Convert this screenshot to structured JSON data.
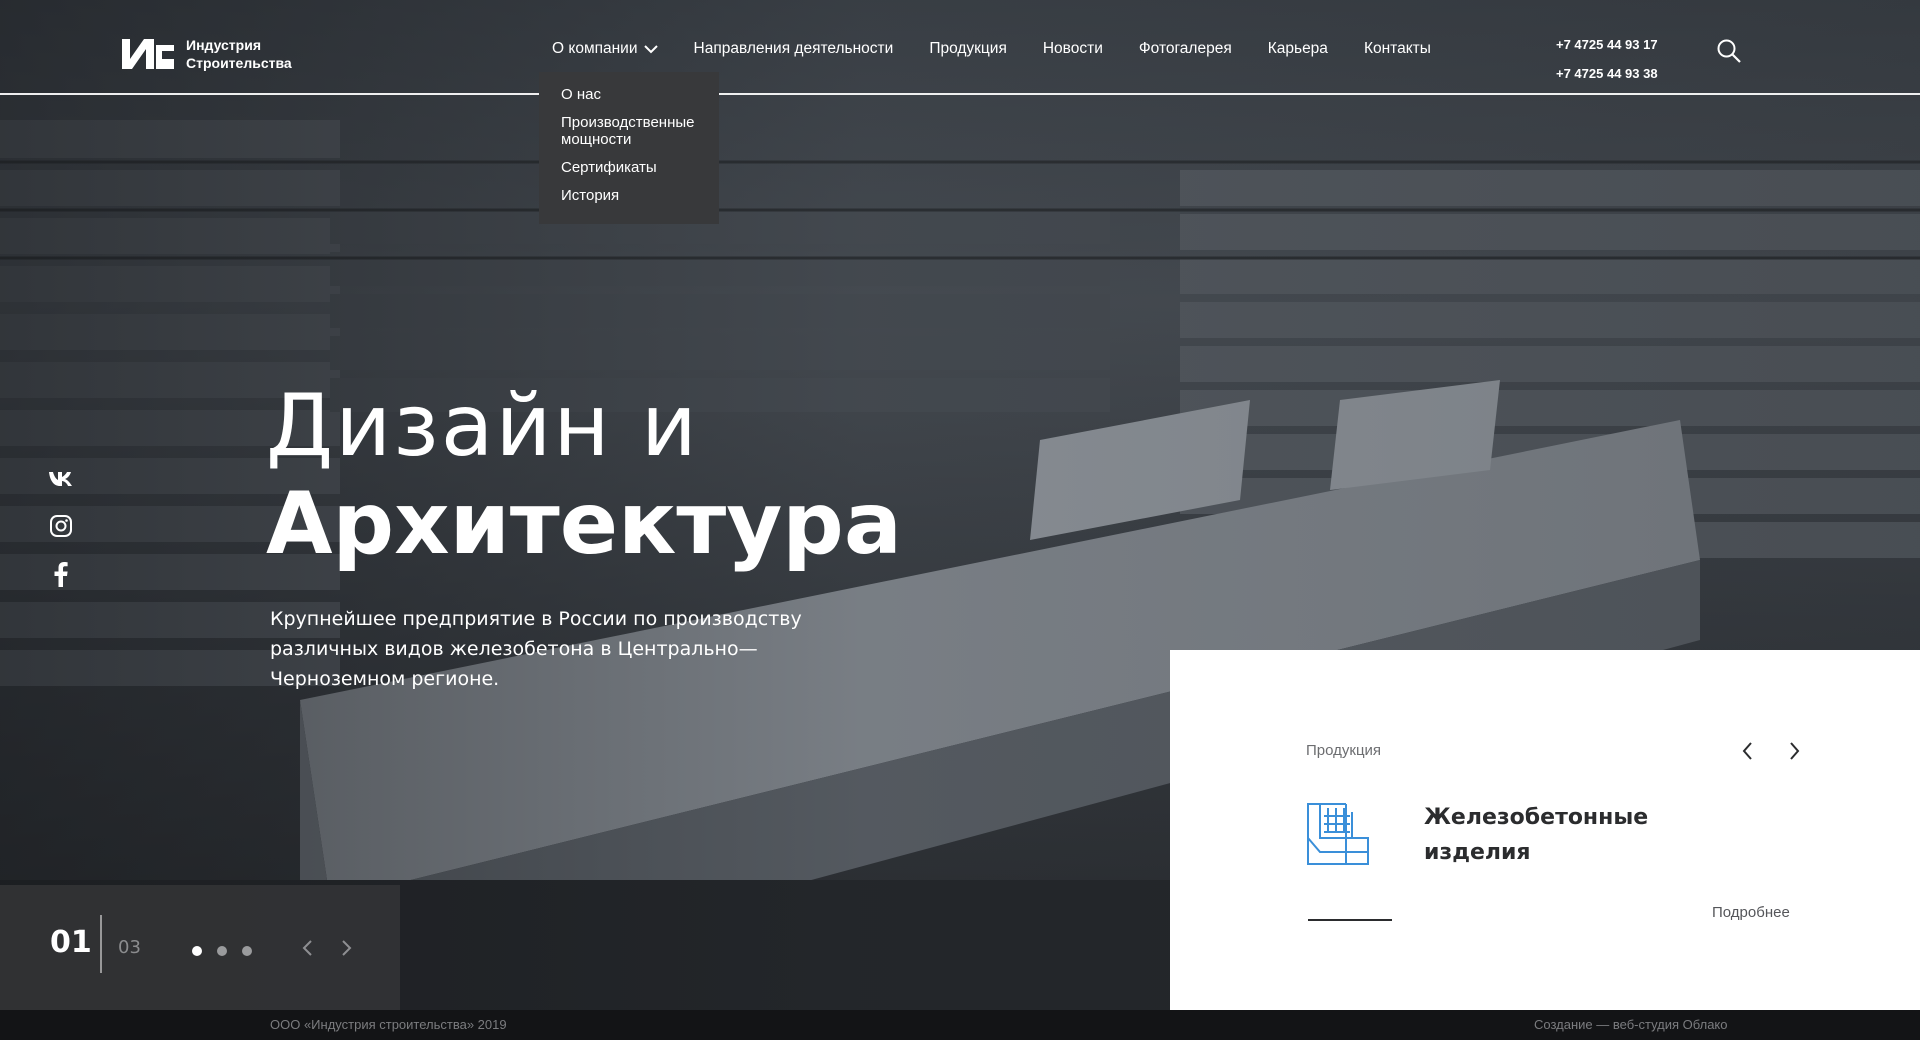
{
  "logo": {
    "line1": "Индустрия",
    "line2": "Строительства"
  },
  "nav": {
    "items": [
      {
        "label": "О компании"
      },
      {
        "label": "Направления деятельности"
      },
      {
        "label": "Продукция"
      },
      {
        "label": "Новости"
      },
      {
        "label": "Фотогалерея"
      },
      {
        "label": "Карьера"
      },
      {
        "label": "Контакты"
      }
    ]
  },
  "dropdown": {
    "items": [
      {
        "label": "О нас"
      },
      {
        "label": "Производственные мощности"
      },
      {
        "label": "Сертификаты"
      },
      {
        "label": "История"
      }
    ]
  },
  "phones": [
    "+7 4725 44 93 17",
    "+7 4725 44 93 38"
  ],
  "social": [
    "vk-icon",
    "instagram-icon",
    "facebook-icon"
  ],
  "hero": {
    "title_line1": "Дизайн и",
    "title_line2": "Архитектура",
    "description": "Крупнейшее предприятие в России по производству различных видов железобетона в Центрально—Черноземном регионе."
  },
  "slider": {
    "current": "01",
    "total": "03",
    "dots": 3,
    "active_dot": 0
  },
  "card": {
    "category": "Продукция",
    "product_name": "Железобетонные изделия",
    "more_label": "Подробнее",
    "icon_color": "#3a8fd9"
  },
  "footer": {
    "copyright": "ООО «Индустрия строительства» 2019",
    "studio": "Создание — веб-студия Облако"
  },
  "colors": {
    "accent": "#3a8fd9",
    "dropdown_bg": "#38393b",
    "card_bg": "#ffffff"
  }
}
